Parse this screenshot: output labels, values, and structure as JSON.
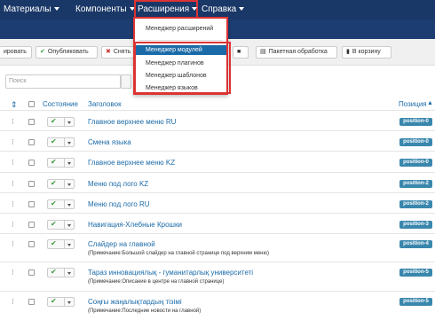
{
  "nav": {
    "materials": "Материалы",
    "components": "Компоненты",
    "extensions": "Расширения",
    "help": "Справка"
  },
  "dropdown": {
    "items": [
      "Менеджер расширений",
      "Менеджер модулей",
      "Менеджер плагинов",
      "Менеджер шаблонов",
      "Менеджер языков"
    ],
    "active_index": 1
  },
  "toolbar": {
    "copy": "ировать",
    "publish": "Опубликовать",
    "unpublish": "Снять",
    "batch": "Пакетная обработка",
    "trash": "В корзину"
  },
  "search": {
    "placeholder": "Поиск"
  },
  "table": {
    "headers": {
      "status": "Состояние",
      "title": "Заголовок",
      "position": "Позиция"
    },
    "rows": [
      {
        "title": "Главное верхнее меню RU",
        "note": "",
        "position": "position-0"
      },
      {
        "title": "Смена языка",
        "note": "",
        "position": "position-0"
      },
      {
        "title": "Главное верхнее меню KZ",
        "note": "",
        "position": "position-0"
      },
      {
        "title": "Меню под лого KZ",
        "note": "",
        "position": "position-2"
      },
      {
        "title": "Меню под лого RU",
        "note": "",
        "position": "position-2"
      },
      {
        "title": "Навигация-Хлебные Крошки",
        "note": "",
        "position": "position-3"
      },
      {
        "title": "Слайдер на главной",
        "note": "(Примечание:Большой слайдер на главной странице под верхним меню)",
        "position": "position-4"
      },
      {
        "title": "Тараз инновациялық - гуманитарлық университеті",
        "note": "(Примечание:Описание в центре на главной странице)",
        "position": "position-5"
      },
      {
        "title": "Соңғы жаңалықтардың тізімі",
        "note": "(Примечание:Последние новости на главной)",
        "position": "position-5"
      }
    ]
  },
  "colors": {
    "nav_bg": "#1a3867",
    "link": "#1a6aa8",
    "badge": "#3a87ad",
    "highlight": "#dd3333"
  }
}
